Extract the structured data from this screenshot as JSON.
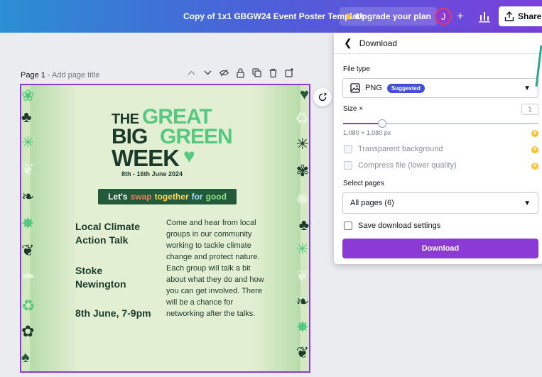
{
  "topbar": {
    "doc_title": "Copy of 1x1 GBGW24 Event Poster Template",
    "upgrade_label": "Upgrade your plan",
    "avatar_initial": "J",
    "plus_label": "+",
    "share_label": "Share",
    "gradient": [
      "#2a8fd4",
      "#4a62d8",
      "#7a3fdc"
    ]
  },
  "page": {
    "label": "Page 1",
    "separator": " - ",
    "title_placeholder": "Add page title",
    "tools": [
      "chevron-up-icon",
      "chevron-down-icon",
      "hide-icon",
      "lock-icon",
      "duplicate-icon",
      "trash-icon",
      "add-page-icon"
    ]
  },
  "poster": {
    "title_the": "THE",
    "title_great": "GREAT",
    "title_big": "BIG",
    "title_green": "GREEN",
    "title_week": "WEEK",
    "dates": "8th - 16th June 2024",
    "banner": [
      "Let's",
      "swap",
      "together",
      "for",
      "good"
    ],
    "event_title": "Local Climate Action Talk",
    "location": "Stoke Newington",
    "time": "8th June, 7-9pm",
    "description": "Come and hear from local groups in our community working to tackle climate change and protect nature. Each group will talk a bit about what they do and how you can get involved. There will be a chance for networking after the talks.",
    "colors": {
      "dark_green": "#1c3a2a",
      "light_green": "#57c87f",
      "background": "#e3efd3"
    }
  },
  "download_panel": {
    "title": "Download",
    "file_type_label": "File type",
    "file_type_value": "PNG",
    "suggested_badge": "Suggested",
    "size_label": "Size ×",
    "size_value": "1",
    "size_fraction": 0.2,
    "dimensions": "1,080 × 1,080 px",
    "transparent_label": "Transparent background",
    "compress_label": "Compress file (lower quality)",
    "select_pages_label": "Select pages",
    "pages_value": "All pages (6)",
    "save_settings_label": "Save download settings",
    "download_button": "Download",
    "accent": "#8b3ad6",
    "pro_color": "#ffbf2f"
  }
}
